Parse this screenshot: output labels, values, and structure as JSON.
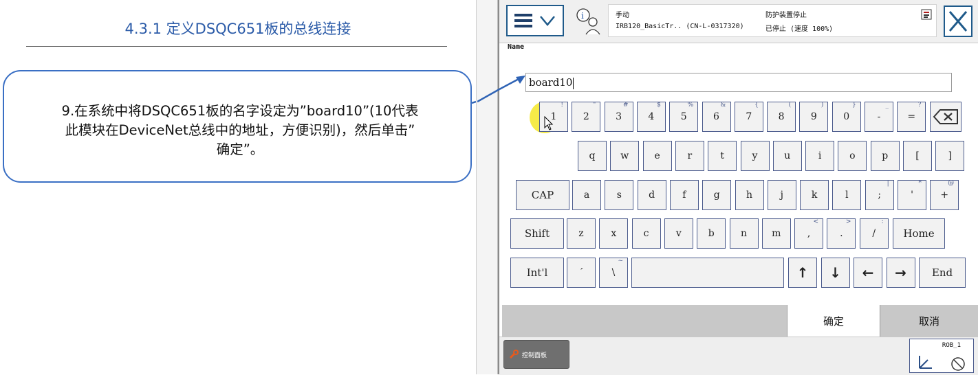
{
  "slide": {
    "title": "4.3.1  定义DSQC651板的总线连接",
    "callout_lines": [
      "9.在系统中将DSQC651板的名字设定为”board10”(10代表",
      "此模块在DeviceNet总线中的地址，方便识别)，然后单击”",
      "确定”。"
    ]
  },
  "status_bar": {
    "mode": "手动",
    "robot": "IRB120_BasicTr..  (CN-L-0317320)",
    "safety": "防护装置停止",
    "state": "已停止 (速度 100%)"
  },
  "input": {
    "label": "Name",
    "value": "board10"
  },
  "keyboard": {
    "row1": [
      {
        "key": "1",
        "sec": "!"
      },
      {
        "key": "2",
        "sec": "\""
      },
      {
        "key": "3",
        "sec": "#"
      },
      {
        "key": "4",
        "sec": "$"
      },
      {
        "key": "5",
        "sec": "%"
      },
      {
        "key": "6",
        "sec": "&"
      },
      {
        "key": "7",
        "sec": "{"
      },
      {
        "key": "8",
        "sec": "("
      },
      {
        "key": "9",
        "sec": ")"
      },
      {
        "key": "0",
        "sec": "}"
      },
      {
        "key": "-",
        "sec": "_"
      },
      {
        "key": "=",
        "sec": "?"
      }
    ],
    "row2": [
      "q",
      "w",
      "e",
      "r",
      "t",
      "y",
      "u",
      "i",
      "o",
      "p",
      "[",
      "]"
    ],
    "row3": [
      {
        "key": "a",
        "sec": ""
      },
      {
        "key": "s",
        "sec": ""
      },
      {
        "key": "d",
        "sec": ""
      },
      {
        "key": "f",
        "sec": ""
      },
      {
        "key": "g",
        "sec": ""
      },
      {
        "key": "h",
        "sec": ""
      },
      {
        "key": "j",
        "sec": ""
      },
      {
        "key": "k",
        "sec": ""
      },
      {
        "key": "l",
        "sec": ""
      },
      {
        "key": ";",
        "sec": "|"
      },
      {
        "key": "'",
        "sec": "*"
      },
      {
        "key": "+",
        "sec": "@"
      }
    ],
    "row4": [
      {
        "key": "z",
        "sec": ""
      },
      {
        "key": "x",
        "sec": ""
      },
      {
        "key": "c",
        "sec": ""
      },
      {
        "key": "v",
        "sec": ""
      },
      {
        "key": "b",
        "sec": ""
      },
      {
        "key": "n",
        "sec": ""
      },
      {
        "key": "m",
        "sec": ""
      },
      {
        "key": ",",
        "sec": "<"
      },
      {
        "key": ".",
        "sec": ">"
      },
      {
        "key": "/",
        "sec": ":"
      }
    ],
    "caps": "CAP",
    "shift": "Shift",
    "home": "Home",
    "intl": "Int'l",
    "end": "End",
    "tick": "´",
    "tick_sec": "",
    "backslash": "\\",
    "backslash_sec": "~",
    "arrows": [
      "↑",
      "↓",
      "←",
      "→"
    ]
  },
  "buttons": {
    "confirm": "确定",
    "cancel": "取消"
  },
  "footer": {
    "control_panel": "控制面板",
    "robot_unit": "ROB_1"
  },
  "colors": {
    "title_blue": "#2b5ba8",
    "callout_border": "#3a6fc4",
    "key_border": "#4a5a8c",
    "highlight": "#f5e828"
  },
  "icons": [
    "menu-icon",
    "chevron-down-icon",
    "info-person-icon",
    "close-icon",
    "backspace-icon",
    "wrench-icon",
    "coordinate-icon",
    "status-flag-icon"
  ]
}
